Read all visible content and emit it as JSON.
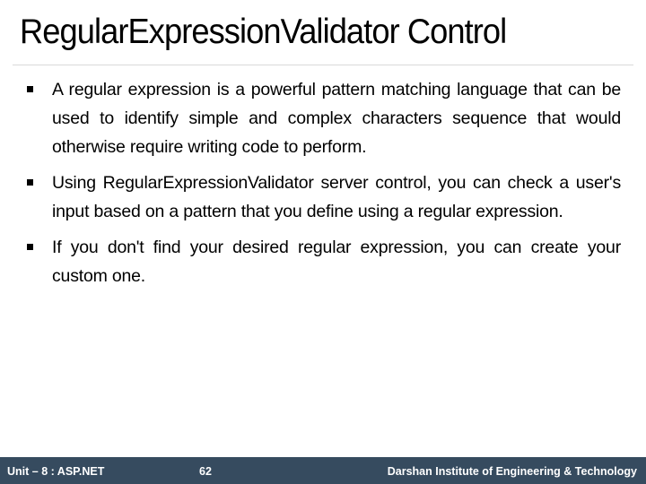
{
  "slide": {
    "title": "RegularExpressionValidator Control",
    "bullets": [
      "A regular expression is a powerful pattern matching language that can be used to identify simple and complex characters sequence that would otherwise require writing code to perform.",
      "Using RegularExpressionValidator server control, you can check a user's input based on a pattern that you define using a regular expression.",
      "If you don't find your desired regular expression, you can create your custom one."
    ]
  },
  "footer": {
    "unit": "Unit – 8 : ASP.NET",
    "page_number": "62",
    "institute": "Darshan Institute of Engineering & Technology",
    "background_color": "#364b5f"
  }
}
